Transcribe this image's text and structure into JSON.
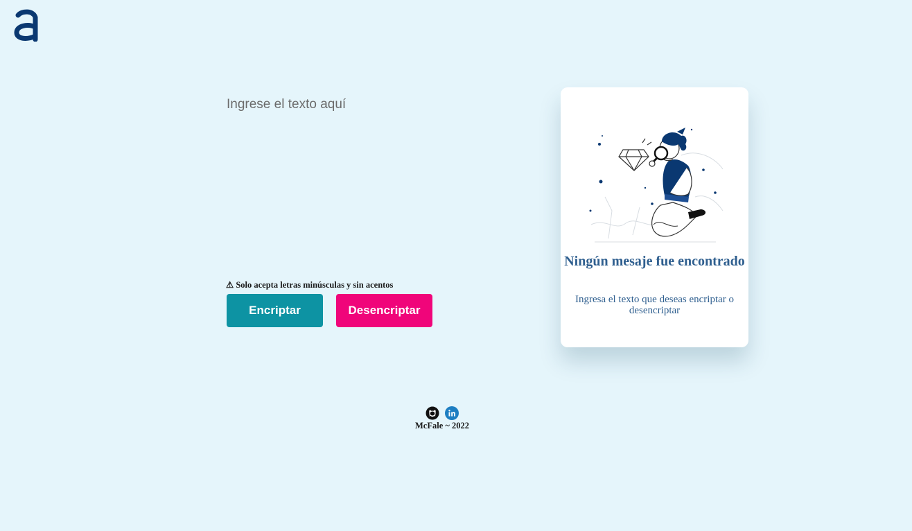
{
  "logo": {
    "icon": "alura-a-logo-icon",
    "color": "#0a3871"
  },
  "editor": {
    "placeholder": "Ingrese el texto aquí",
    "value": ""
  },
  "warning": {
    "icon": "warning-icon",
    "text": "⚠ Solo acepta letras minúsculas y sin acentos"
  },
  "actions": {
    "encrypt_label": "Encriptar",
    "decrypt_label": "Desencriptar",
    "encrypt_color": "#0d93a3",
    "decrypt_color": "#f0057a"
  },
  "result_panel": {
    "illustration": "person-with-magnifying-glass-illustration",
    "title": "Ningún mesaje fue encontrado",
    "subtitle": "Ingresa el texto que deseas encriptar o desencriptar"
  },
  "footer": {
    "icons": [
      "github-icon",
      "linkedin-icon"
    ],
    "credit": "McFale ~ 2022"
  }
}
